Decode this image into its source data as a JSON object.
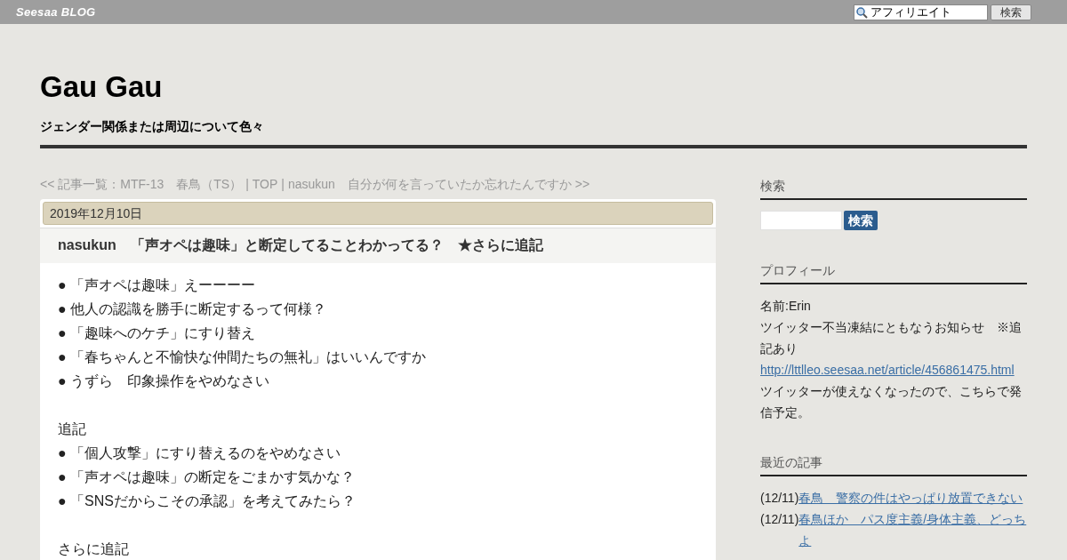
{
  "topbar": {
    "logo": "Seesaa BLOG",
    "search_value": "アフィリエイト",
    "search_button": "検索"
  },
  "blog": {
    "title": "Gau Gau",
    "subtitle": "ジェンダー関係または周辺について色々"
  },
  "nav": {
    "prev": "<< 記事一覧：MTF-13　春鳥（TS）",
    "separator_1": "|",
    "top": "TOP",
    "separator_2": "|",
    "next": "nasukun　自分が何を言っていたか忘れたんですか >>"
  },
  "article": {
    "date": "2019年12月10日",
    "title": "nasukun　「声オペは趣味」と断定してることわかってる？　★さらに追記",
    "paragraphs": [
      {
        "lines": [
          "● 「声オペは趣味」えーーーー",
          "● 他人の認識を勝手に断定するって何様？",
          "● 「趣味へのケチ」にすり替え",
          "● 「春ちゃんと不愉快な仲間たちの無礼」はいいんですか",
          "● うずら　印象操作をやめなさい"
        ]
      },
      {
        "lines": [
          "追記",
          "● 「個人攻撃」にすり替えるのをやめなさい",
          "● 「声オペは趣味」の断定をごまかす気かな？",
          "● 「SNSだからこその承認」を考えてみたら？"
        ]
      },
      {
        "lines": [
          "さらに追記"
        ]
      }
    ]
  },
  "sidebar": {
    "search": {
      "heading": "検索",
      "button": "検索"
    },
    "profile": {
      "heading": "プロフィール",
      "lines": [
        {
          "kind": "text",
          "text": "名前:Erin"
        },
        {
          "kind": "text",
          "text": "ツイッター不当凍結にともなうお知らせ　※追記あり"
        },
        {
          "kind": "link",
          "text": "http://lttlleo.seesaa.net/article/456861475.html"
        },
        {
          "kind": "text",
          "text": "ツイッターが使えなくなったので、こちらで発信予定。"
        }
      ]
    },
    "recent": {
      "heading": "最近の記事",
      "items": [
        {
          "date": "(12/11)",
          "title": "春鳥　警察の件はやっぱり放置できない"
        },
        {
          "date": "(12/11)",
          "title": "春鳥ほか　パス度主義/身体主義、どっちよ"
        }
      ]
    }
  }
}
